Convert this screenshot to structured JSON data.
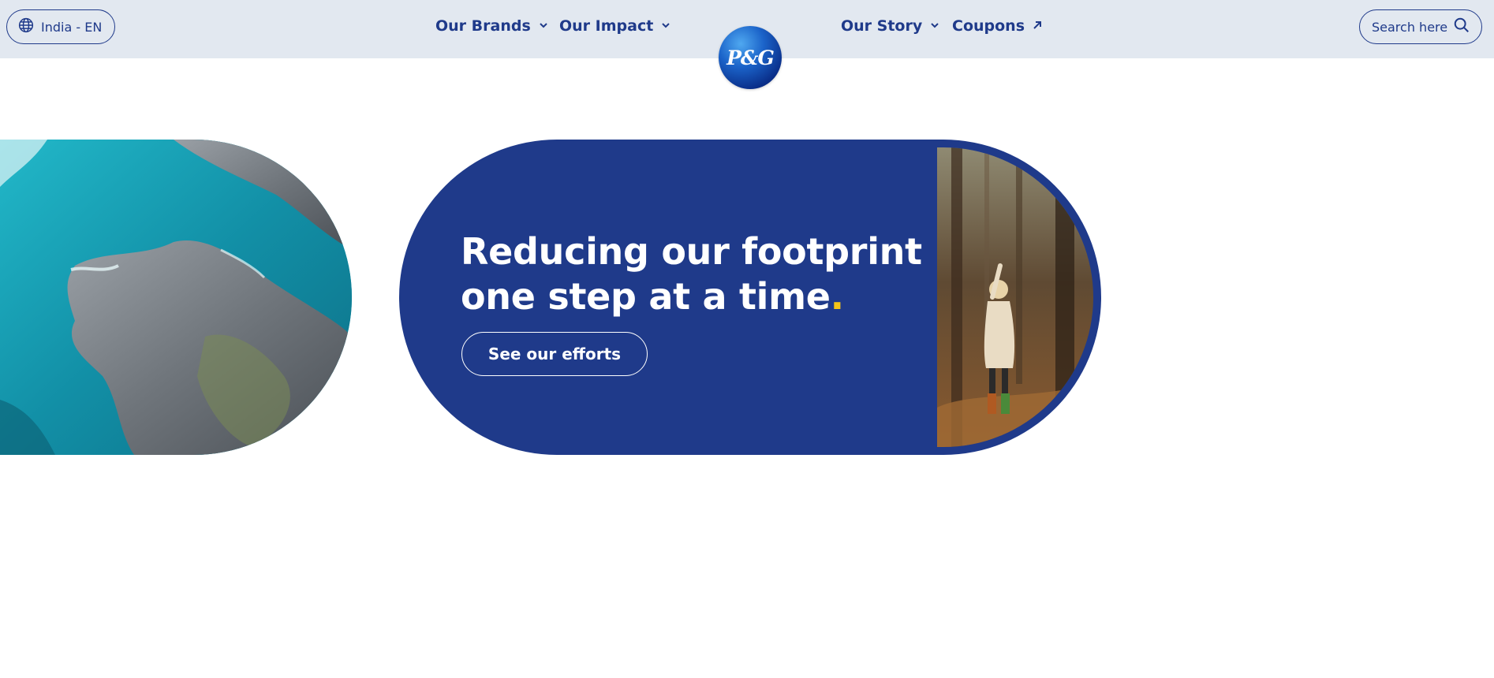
{
  "header": {
    "locale_label": "India - EN",
    "nav": [
      {
        "label": "Our Brands",
        "icon": "chevron-down-icon"
      },
      {
        "label": "Our Impact",
        "icon": "chevron-down-icon"
      },
      {
        "label": "Our Story",
        "icon": "chevron-down-icon"
      },
      {
        "label": "Coupons",
        "icon": "arrow-up-right-icon"
      }
    ],
    "search_label": "Search here"
  },
  "logo": {
    "text": "P&G"
  },
  "hero": {
    "title_line1": "Reducing our footprint",
    "title_line2": "one step at a time",
    "title_dot": ".",
    "cta_label": "See our efforts"
  },
  "colors": {
    "brand_blue": "#1f3a8a",
    "header_bg": "#e2e8f0",
    "accent_yellow": "#f5c518"
  }
}
